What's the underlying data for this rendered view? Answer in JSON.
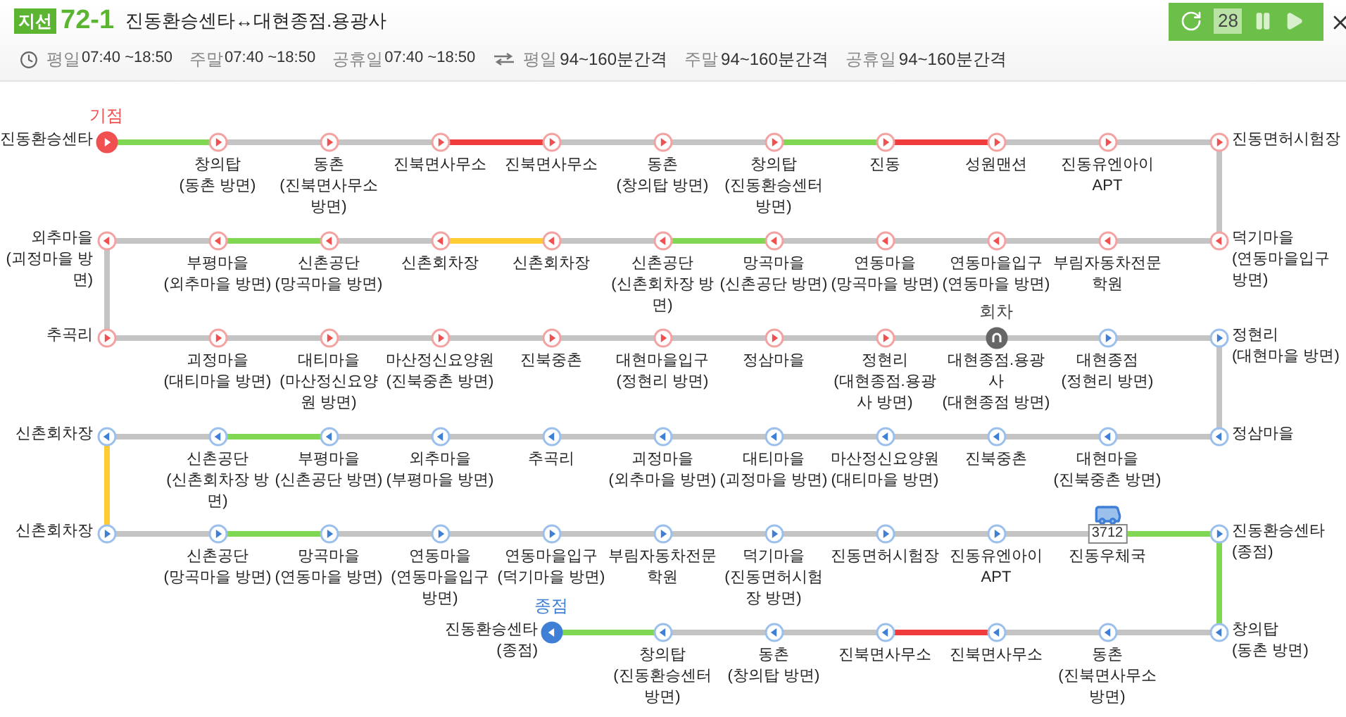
{
  "route": {
    "type": "지선",
    "number": "72-1",
    "title": "진동환승센타↔대현종점.용광사"
  },
  "hours": [
    {
      "label": "평일",
      "value": "07:40 ~18:50"
    },
    {
      "label": "주말",
      "value": "07:40 ~18:50"
    },
    {
      "label": "공휴일",
      "value": "07:40 ~18:50"
    }
  ],
  "intervals": [
    {
      "label": "평일",
      "value": "94~160분간격"
    },
    {
      "label": "주말",
      "value": "94~160분간격"
    },
    {
      "label": "공휴일",
      "value": "94~160분간격"
    }
  ],
  "controls": {
    "countdown": "28"
  },
  "rows": [
    {
      "leftward": false,
      "connector": {
        "color": "#c4c4c4"
      },
      "segments": [
        {
          "color": "#80d852"
        },
        {
          "color": "#c4c4c4"
        },
        {
          "color": "#c4c4c4"
        },
        {
          "color": "#f03c3c"
        },
        {
          "color": "#c4c4c4"
        },
        {
          "color": "#c4c4c4"
        },
        {
          "color": "#80d852"
        },
        {
          "color": "#f03c3c"
        },
        {
          "color": "#c4c4c4"
        },
        {
          "color": "#c4c4c4"
        }
      ],
      "stops": [
        {
          "kind": "start",
          "name": "진동환승센타",
          "marker": "기점"
        },
        {
          "kind": "outbound",
          "name": "창의탑",
          "note": "(동촌 방면)"
        },
        {
          "kind": "outbound",
          "name": "동촌",
          "note": "(진북면사무소 방면)"
        },
        {
          "kind": "outbound",
          "name": "진북면사무소"
        },
        {
          "kind": "outbound",
          "name": "진북면사무소"
        },
        {
          "kind": "outbound",
          "name": "동촌",
          "note": "(창의탑 방면)"
        },
        {
          "kind": "outbound",
          "name": "창의탑",
          "note": "(진동환승센터 방면)"
        },
        {
          "kind": "outbound",
          "name": "진동"
        },
        {
          "kind": "outbound",
          "name": "성원맨션"
        },
        {
          "kind": "outbound",
          "name": "진동유엔아이 APT"
        },
        {
          "kind": "outbound",
          "name": "진동면허시험장"
        }
      ]
    },
    {
      "leftward": true,
      "connector": {
        "color": "#c4c4c4"
      },
      "segments": [
        {
          "color": "#c4c4c4"
        },
        {
          "color": "#80d852"
        },
        {
          "color": "#c4c4c4"
        },
        {
          "color": "#ffcc33"
        },
        {
          "color": "#c4c4c4"
        },
        {
          "color": "#80d852"
        },
        {
          "color": "#c4c4c4"
        },
        {
          "color": "#c4c4c4"
        },
        {
          "color": "#c4c4c4"
        },
        {
          "color": "#c4c4c4"
        }
      ],
      "stops": [
        {
          "kind": "outbound",
          "name": "외추마을",
          "note": "(괴정마을 방면)"
        },
        {
          "kind": "outbound",
          "name": "부평마을",
          "note": "(외추마을 방면)"
        },
        {
          "kind": "outbound",
          "name": "신촌공단",
          "note": "(망곡마을 방면)"
        },
        {
          "kind": "outbound",
          "name": "신촌회차장"
        },
        {
          "kind": "outbound",
          "name": "신촌회차장"
        },
        {
          "kind": "outbound",
          "name": "신촌공단",
          "note": "(신촌회차장 방면)"
        },
        {
          "kind": "outbound",
          "name": "망곡마을",
          "note": "(신촌공단 방면)"
        },
        {
          "kind": "outbound",
          "name": "연동마을",
          "note": "(망곡마을 방면)"
        },
        {
          "kind": "outbound",
          "name": "연동마을입구",
          "note": "(연동마을 방면)"
        },
        {
          "kind": "outbound",
          "name": "부림자동차전문학원"
        },
        {
          "kind": "outbound",
          "name": "덕기마을",
          "note": "(연동마을입구 방면)"
        }
      ]
    },
    {
      "leftward": false,
      "connector": {
        "color": "#c4c4c4"
      },
      "segments": [
        {
          "color": "#c4c4c4"
        },
        {
          "color": "#c4c4c4"
        },
        {
          "color": "#c4c4c4"
        },
        {
          "color": "#c4c4c4"
        },
        {
          "color": "#c4c4c4"
        },
        {
          "color": "#c4c4c4"
        },
        {
          "color": "#c4c4c4"
        },
        {
          "color": "#c4c4c4"
        },
        {
          "color": "#c4c4c4"
        },
        {
          "color": "#c4c4c4"
        }
      ],
      "stops": [
        {
          "kind": "outbound",
          "name": "추곡리"
        },
        {
          "kind": "outbound",
          "name": "괴정마을",
          "note": "(대티마을 방면)"
        },
        {
          "kind": "outbound",
          "name": "대티마을",
          "note": "(마산정신요양원 방면)"
        },
        {
          "kind": "outbound",
          "name": "마산정신요양원",
          "note": "(진북중촌 방면)"
        },
        {
          "kind": "outbound",
          "name": "진북중촌"
        },
        {
          "kind": "outbound",
          "name": "대현마을입구",
          "note": "(정현리 방면)"
        },
        {
          "kind": "outbound",
          "name": "정삼마을"
        },
        {
          "kind": "outbound",
          "name": "정현리",
          "note": "(대현종점.용광사 방면)"
        },
        {
          "kind": "turnaround",
          "name": "대현종점.용광사",
          "note": "(대현종점 방면)",
          "marker": "회차"
        },
        {
          "kind": "inbound",
          "name": "대현종점",
          "note": "(정현리 방면)"
        },
        {
          "kind": "inbound",
          "name": "정현리",
          "note": "(대현마을 방면)"
        }
      ]
    },
    {
      "leftward": true,
      "connector": {
        "color": "#ffcc33"
      },
      "segments": [
        {
          "color": "#c4c4c4"
        },
        {
          "color": "#80d852"
        },
        {
          "color": "#c4c4c4"
        },
        {
          "color": "#c4c4c4"
        },
        {
          "color": "#c4c4c4"
        },
        {
          "color": "#c4c4c4"
        },
        {
          "color": "#c4c4c4"
        },
        {
          "color": "#c4c4c4"
        },
        {
          "color": "#c4c4c4"
        },
        {
          "color": "#c4c4c4"
        }
      ],
      "stops": [
        {
          "kind": "inbound",
          "name": "신촌회차장"
        },
        {
          "kind": "inbound",
          "name": "신촌공단",
          "note": "(신촌회차장 방면)"
        },
        {
          "kind": "inbound",
          "name": "부평마을",
          "note": "(신촌공단 방면)"
        },
        {
          "kind": "inbound",
          "name": "외추마을",
          "note": "(부평마을 방면)"
        },
        {
          "kind": "inbound",
          "name": "추곡리"
        },
        {
          "kind": "inbound",
          "name": "괴정마을",
          "note": "(외추마을 방면)"
        },
        {
          "kind": "inbound",
          "name": "대티마을",
          "note": "(괴정마을 방면)"
        },
        {
          "kind": "inbound",
          "name": "마산정신요양원",
          "note": "(대티마을 방면)"
        },
        {
          "kind": "inbound",
          "name": "진북중촌"
        },
        {
          "kind": "inbound",
          "name": "대현마을",
          "note": "(진북중촌 방면)"
        },
        {
          "kind": "inbound",
          "name": "정삼마을"
        }
      ]
    },
    {
      "leftward": false,
      "connector": {
        "color": "#80d852"
      },
      "segments": [
        {
          "color": "#c4c4c4"
        },
        {
          "color": "#80d852"
        },
        {
          "color": "#c4c4c4"
        },
        {
          "color": "#c4c4c4"
        },
        {
          "color": "#c4c4c4"
        },
        {
          "color": "#c4c4c4"
        },
        {
          "color": "#c4c4c4"
        },
        {
          "color": "#c4c4c4"
        },
        {
          "color": "#c4c4c4"
        },
        {
          "color": "#80d852"
        }
      ],
      "stops": [
        {
          "kind": "inbound",
          "name": "신촌회차장"
        },
        {
          "kind": "inbound",
          "name": "신촌공단",
          "note": "(망곡마을 방면)"
        },
        {
          "kind": "inbound",
          "name": "망곡마을",
          "note": "(연동마을 방면)"
        },
        {
          "kind": "inbound",
          "name": "연동마을",
          "note": "(연동마을입구 방면)"
        },
        {
          "kind": "inbound",
          "name": "연동마을입구",
          "note": "(덕기마을 방면)"
        },
        {
          "kind": "inbound",
          "name": "부림자동차전문학원"
        },
        {
          "kind": "inbound",
          "name": "덕기마을",
          "note": "(진동면허시험장 방면)"
        },
        {
          "kind": "inbound",
          "name": "진동면허시험장"
        },
        {
          "kind": "inbound",
          "name": "진동유엔아이 APT"
        },
        {
          "kind": "inbound",
          "name": "진동우체국",
          "bus": {
            "number": "3712"
          }
        },
        {
          "kind": "inbound",
          "name": "진동환승센타",
          "note": "(종점)"
        }
      ]
    },
    {
      "leftward": true,
      "segments": [
        {
          "color": "#80d852"
        },
        {
          "color": "#c4c4c4"
        },
        {
          "color": "#c4c4c4"
        },
        {
          "color": "#f03c3c"
        },
        {
          "color": "#c4c4c4"
        },
        {
          "color": "#c4c4c4"
        }
      ],
      "stops": [
        {
          "kind": "end",
          "name": "진동환승센타",
          "note": "(종점)",
          "marker": "종점"
        },
        {
          "kind": "inbound",
          "name": "창의탑",
          "note": "(진동환승센터 방면)"
        },
        {
          "kind": "inbound",
          "name": "동촌",
          "note": "(창의탑 방면)"
        },
        {
          "kind": "inbound",
          "name": "진북면사무소"
        },
        {
          "kind": "inbound",
          "name": "진북면사무소"
        },
        {
          "kind": "inbound",
          "name": "동촌",
          "note": "(진북면사무소 방면)"
        },
        {
          "kind": "inbound",
          "name": "창의탑",
          "note": "(동촌 방면)"
        }
      ]
    }
  ]
}
